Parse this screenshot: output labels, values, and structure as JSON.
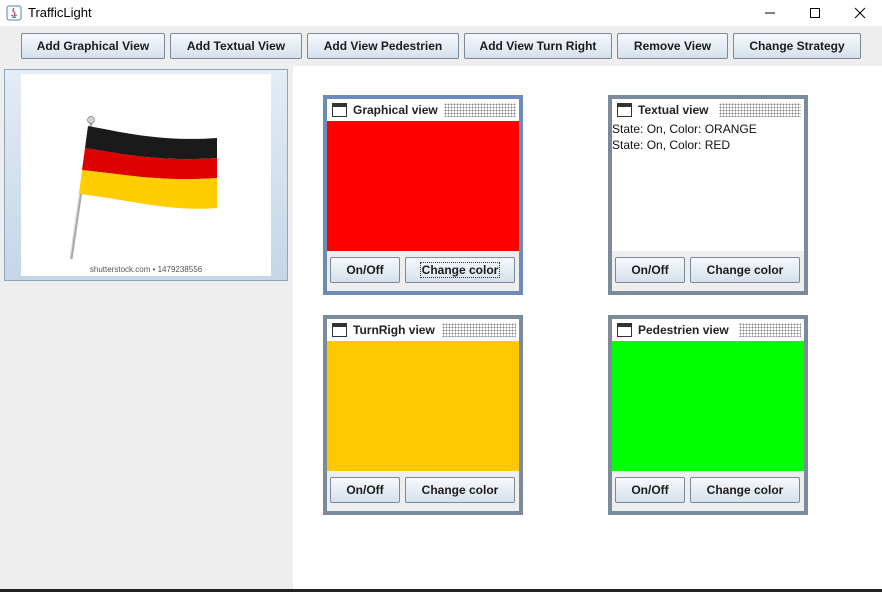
{
  "window": {
    "title": "TrafficLight"
  },
  "toolbar": {
    "add_graphical_view": "Add Graphical View",
    "add_textual_view": "Add Textual View",
    "add_view_pedestrien": "Add View Pedestrien",
    "add_view_turn_right": "Add View Turn Right",
    "remove_view": "Remove View",
    "change_strategy": "Change Strategy"
  },
  "image_panel": {
    "watermark": "shutterstock.com • 1479238556",
    "flag_colors": [
      "#1a1a1a",
      "#dd0000",
      "#ffce00"
    ]
  },
  "frames": {
    "graphical": {
      "title": "Graphical view",
      "color": "#ff0000",
      "onoff_label": "On/Off",
      "change_label": "Change color"
    },
    "textual": {
      "title": "Textual view",
      "lines": [
        "State: On, Color: ORANGE",
        "State: On, Color: RED"
      ],
      "onoff_label": "On/Off",
      "change_label": "Change color"
    },
    "turnright": {
      "title": "TurnRigh view",
      "color": "#ffc800",
      "onoff_label": "On/Off",
      "change_label": "Change color"
    },
    "pedestrien": {
      "title": "Pedestrien view",
      "color": "#00ff00",
      "onoff_label": "On/Off",
      "change_label": "Change color"
    }
  }
}
